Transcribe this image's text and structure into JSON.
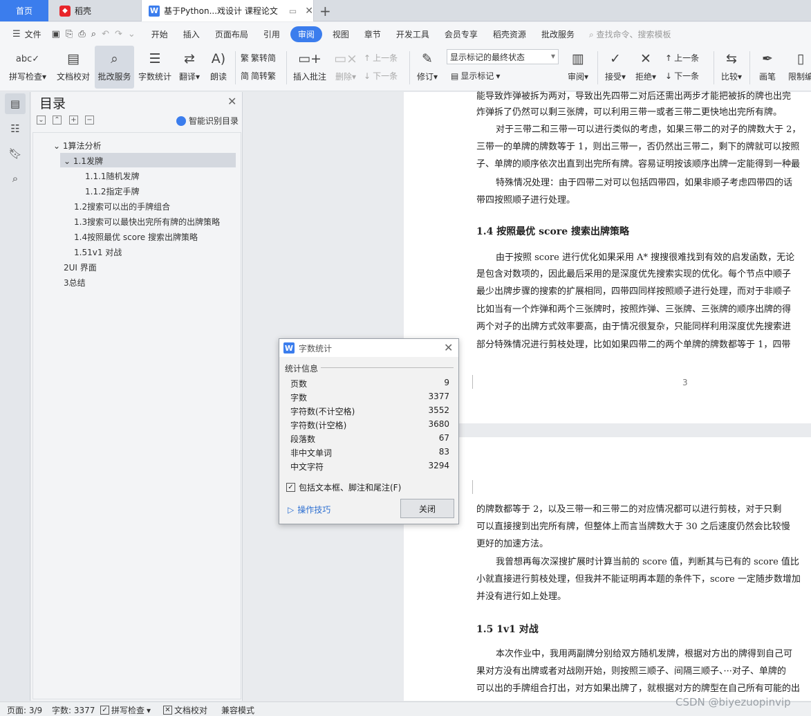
{
  "tabs": {
    "home": "首页",
    "shell": "稻壳",
    "doc": "基于Python...戏设计 课程论文",
    "new_tab": "+"
  },
  "menu": {
    "file": "文件",
    "items": [
      "开始",
      "插入",
      "页面布局",
      "引用",
      "审阅",
      "视图",
      "章节",
      "开发工具",
      "会员专享",
      "稻壳资源",
      "批改服务"
    ],
    "active": "审阅",
    "search_placeholder": "查找命令、搜索模板"
  },
  "ribbon": {
    "spell_check": "拼写检查",
    "doc_proof": "文档校对",
    "review_service": "批改服务",
    "word_count": "字数统计",
    "translate": "翻译",
    "read_aloud": "朗读",
    "trad_to_simp": "繁转简",
    "simp_to_trad": "简转繁",
    "insert_comment": "插入批注",
    "delete": "删除",
    "prev_comment": "上一条",
    "next_comment": "下一条",
    "track_changes": "修订",
    "markup_state": "显示标记的最终状态",
    "show_markup": "显示标记",
    "review": "审阅",
    "accept": "接受",
    "reject": "拒绝",
    "prev_change": "上一条",
    "next_change": "下一条",
    "compare": "比较",
    "pen": "画笔",
    "restrict": "限制编"
  },
  "toc": {
    "title": "目录",
    "smart_toc": "智能识别目录",
    "items": [
      {
        "label": "1算法分析"
      },
      {
        "label": "1.1发牌"
      },
      {
        "label": "1.1.1随机发牌"
      },
      {
        "label": "1.1.2指定手牌"
      },
      {
        "label": "1.2搜索可以出的手牌组合"
      },
      {
        "label": "1.3搜索可以最快出完所有牌的出牌策略"
      },
      {
        "label": "1.4按照最优 score 搜索出牌策略"
      },
      {
        "label": "1.51v1 对战"
      },
      {
        "label": "2UI 界面"
      },
      {
        "label": "3总结"
      }
    ]
  },
  "document": {
    "page1_lines": [
      "能导致炸弹被拆为两对，导致出先四带二对后还需出两步才能把被拆的牌也出完",
      "炸弹拆了仍然可以剩三张牌，可以利用三带一或者三带二更快地出完所有牌。",
      "对于三带二和三带一可以进行类似的考虑，如果三带二的对子的牌数大于 2，",
      "三带一的单牌的牌数等于 1，则出三带一，否仍然出三带二，剩下的牌就可以按照",
      "子、单牌的顺序依次出直到出完所有牌。容易证明按该顺序出牌一定能得到一种最",
      "特殊情况处理：由于四带二对可以包括四带四，如果非顺子考虑四带四的话",
      "带四按照顺子进行处理。"
    ],
    "heading_1_4": "1.4    按照最优 score 搜索出牌策略",
    "section_1_4_lines": [
      "由于按照 score 进行优化如果采用 A* 搜搜很难找到有效的启发函数，无论",
      "是包含对数项的，因此最后采用的是深度优先搜索实现的优化。每个节点中顺子",
      "最少出牌步骤的搜索的扩展相同，四带四同样按照顺子进行处理，而对于非顺子",
      "比如当有一个炸弹和两个三张牌时，按照炸弹、三张牌、三张牌的顺序出牌的得",
      "两个对子的出牌方式效率要高，由于情况很复杂，只能同样利用深度优先搜索进",
      "部分特殊情况进行剪枝处理，比如如果四带二的两个单牌的牌数都等于 1，四带"
    ],
    "page_number": "3",
    "page2_lines": [
      "的牌数都等于 2，以及三带一和三带二的对应情况都可以进行剪枝，对于只剩",
      "可以直接搜到出完所有牌，但整体上而言当牌数大于 30 之后速度仍然会比较慢",
      "更好的加速方法。",
      "我曾想再每次深搜扩展时计算当前的 score 值，判断其与已有的 score 值比",
      "小就直接进行剪枝处理，但我并不能证明再本题的条件下，score 一定随步数增加",
      "并没有进行如上处理。"
    ],
    "heading_1_5": "1.5    1v1 对战",
    "section_1_5_lines": [
      "本次作业中，我用两副牌分别给双方随机发牌，根据对方出的牌得到自己可",
      "果对方没有出牌或者对战刚开始，则按照三顺子、间隔三顺子、···对子、单牌的",
      "可以出的手牌组合打出，对方如果出牌了，就根据对方的牌型在自己所有可能的出"
    ]
  },
  "dialog": {
    "title": "字数统计",
    "section": "统计信息",
    "stats": [
      {
        "label": "页数",
        "value": "9"
      },
      {
        "label": "字数",
        "value": "3377"
      },
      {
        "label": "字符数(不计空格)",
        "value": "3552"
      },
      {
        "label": "字符数(计空格)",
        "value": "3680"
      },
      {
        "label": "段落数",
        "value": "67"
      },
      {
        "label": "非中文单词",
        "value": "83"
      },
      {
        "label": "中文字符",
        "value": "3294"
      }
    ],
    "include_checkbox": "包括文本框、脚注和尾注(F)",
    "tips": "操作技巧",
    "close": "关闭"
  },
  "status": {
    "page": "页面: 3/9",
    "words": "字数: 3377",
    "spell": "拼写检查",
    "proof": "文档校对",
    "compat": "兼容模式"
  },
  "watermark": "CSDN @biyezuopinvip"
}
